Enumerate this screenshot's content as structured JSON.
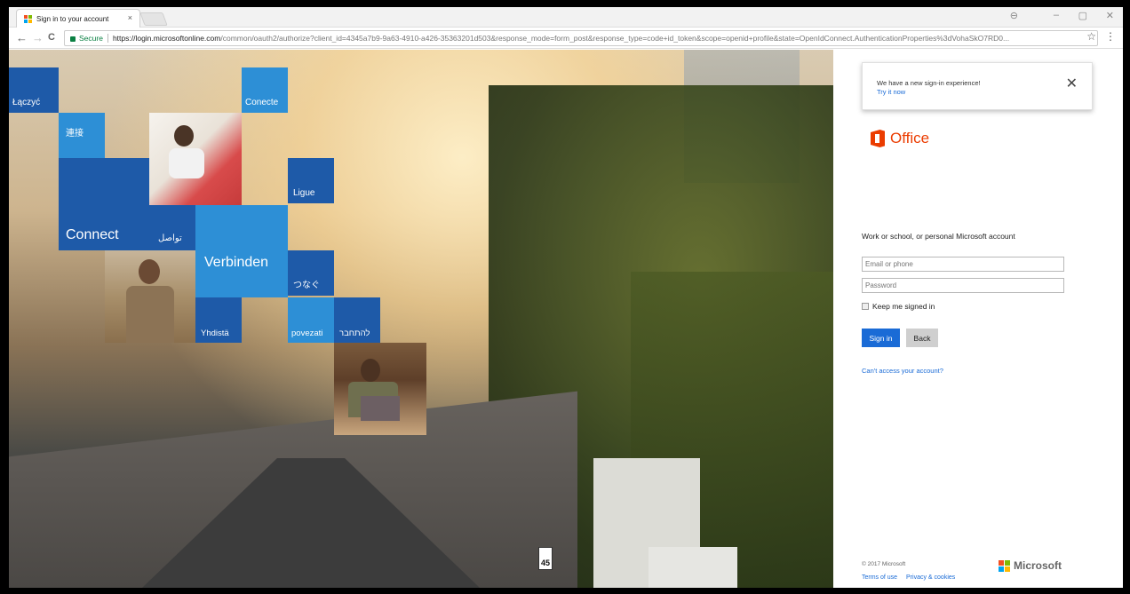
{
  "browser": {
    "tab_title": "Sign in to your account",
    "tab_close": "×",
    "secure_label": "Secure",
    "url_host": "https://login.microsoftonline.com",
    "url_rest": "/common/oauth2/authorize?client_id=4345a7b9-9a63-4910-a426-35363201d503&response_mode=form_post&response_type=code+id_token&scope=openid+profile&state=OpenIdConnect.AuthenticationProperties%3dVohaSkO7RD0...",
    "back_icon": "←",
    "forward_icon": "→",
    "reload_icon": "C",
    "star_icon": "☆",
    "menu_icon": "⋮",
    "profile_icon": "⊖",
    "minimize_icon": "–",
    "restore_icon": "▢",
    "close_icon": "✕"
  },
  "hero_tiles": {
    "laczyc": "Łączyć",
    "conecte": "Conecte",
    "lianjie": "連接",
    "ligue": "Ligue",
    "connect": "Connect",
    "tawasal": "تواصل",
    "verbinden": "Verbinden",
    "tsunagu": "つなぐ",
    "yhdista": "Yhdistä",
    "povezati": "povezati",
    "lehitkaber": "להתחבר"
  },
  "notice": {
    "text": "We have a new sign-in experience!",
    "link": "Try it now",
    "close": "✕"
  },
  "brand": {
    "product": "Office",
    "color": "#eb3c00"
  },
  "signin": {
    "account_label": "Work or school, or personal Microsoft account",
    "email_placeholder": "Email or phone",
    "password_placeholder": "Password",
    "keep_signed_in": "Keep me signed in",
    "signin_button": "Sign in",
    "back_button": "Back",
    "cant_access": "Can't access your account?"
  },
  "footer": {
    "copyright": "© 2017 Microsoft",
    "terms": "Terms of use",
    "privacy": "Privacy & cookies",
    "microsoft": "Microsoft"
  },
  "colors": {
    "primary": "#1a6bd6",
    "tile_dark": "#1e5aa8",
    "tile_light": "#2d8fd6"
  }
}
